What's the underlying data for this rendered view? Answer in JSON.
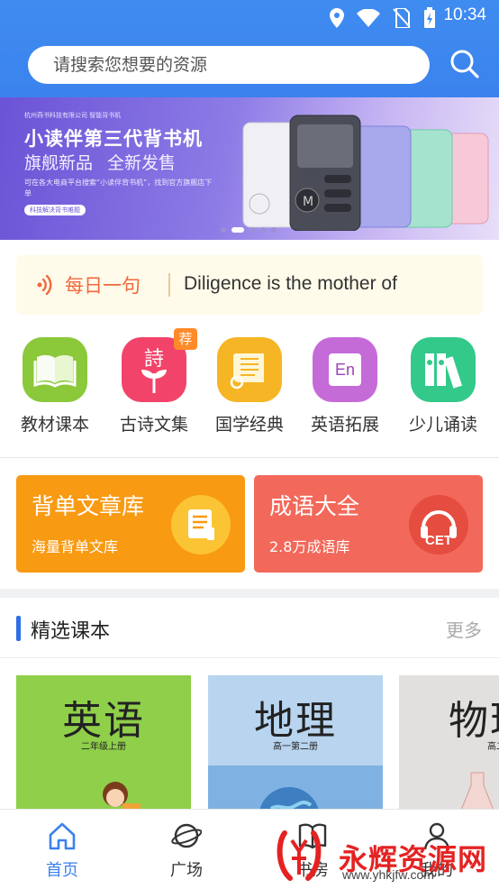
{
  "status_bar": {
    "time": "10:34"
  },
  "search": {
    "placeholder": "请搜索您想要的资源"
  },
  "banner": {
    "small_text": "杭州燕书科技有限公司  智能背书机",
    "title": "小读伴第三代背书机",
    "sub1": "旗舰新品",
    "sub2": "全新发售",
    "desc": "可在各大电商平台搜索“小读伴背书机”，找到官方旗舰店下单",
    "tag": "科技解决背书难题"
  },
  "daily": {
    "label": "每日一句",
    "text": "Diligence is the mother of"
  },
  "categories": [
    {
      "label": "教材课本",
      "color": "#8bc83a"
    },
    {
      "label": "古诗文集",
      "color": "#f2446a",
      "badge": "荐",
      "glyph": "詩"
    },
    {
      "label": "国学经典",
      "color": "#f6b524"
    },
    {
      "label": "英语拓展",
      "color": "#c56bd8",
      "glyph": "En"
    },
    {
      "label": "少儿诵读",
      "color": "#33c98a"
    }
  ],
  "cards": [
    {
      "title": "背单文章库",
      "sub": "海量背单文库",
      "color": "#f89a12"
    },
    {
      "title": "成语大全",
      "sub": "2.8万成语库",
      "color": "#f2685a",
      "icon_text": "CET"
    }
  ],
  "section": {
    "title": "精选课本",
    "more": "更多"
  },
  "books": [
    {
      "title": "英语",
      "grade": "二年级上册",
      "color": "#8fcf4a"
    },
    {
      "title": "地理",
      "grade": "高一第二册",
      "color": "#7fb2e2"
    },
    {
      "title": "物理",
      "grade": "高二第二",
      "color": "#e2e0de"
    }
  ],
  "nav": [
    {
      "label": "首页"
    },
    {
      "label": "广场"
    },
    {
      "label": "书房"
    },
    {
      "label": "我的"
    }
  ],
  "watermark": {
    "text": "永辉资源网",
    "url": "www.yhkjfw.com"
  }
}
